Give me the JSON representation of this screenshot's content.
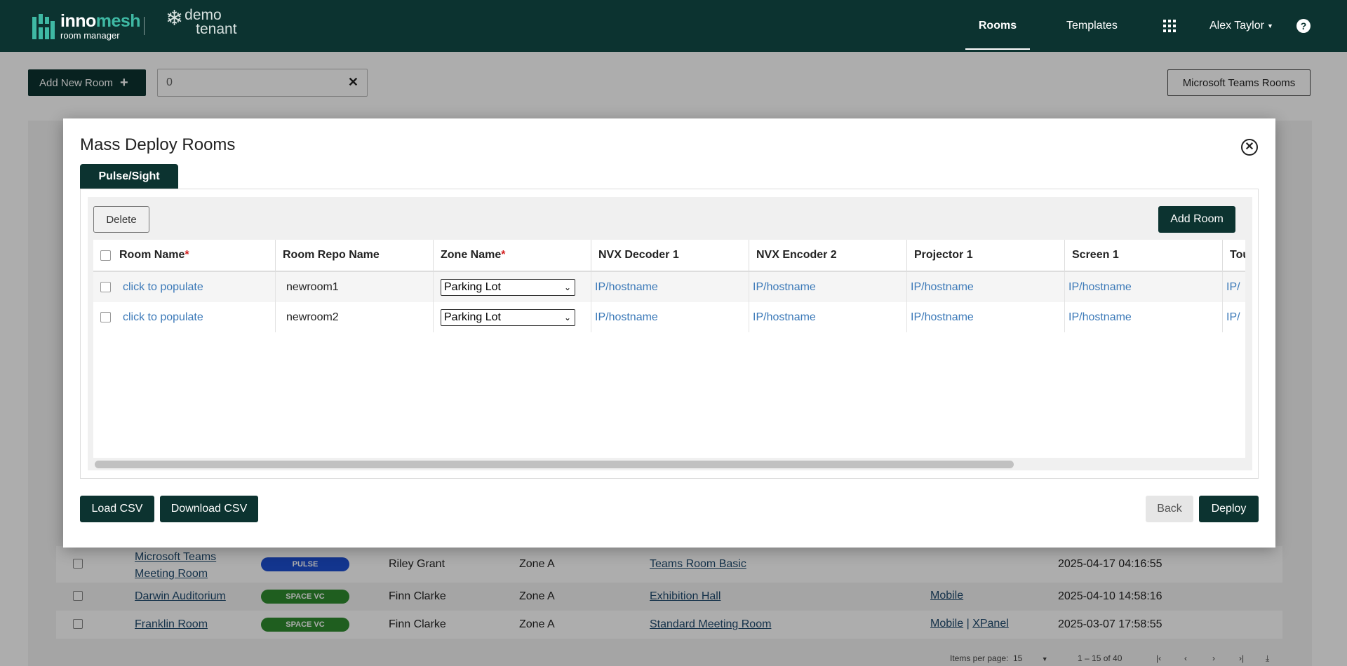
{
  "header": {
    "logo_brand_light": "inno",
    "logo_brand_bold": "mesh",
    "logo_sub": "room manager",
    "tenant_line1": "demo",
    "tenant_line2": "tenant",
    "nav": {
      "rooms": "Rooms",
      "templates": "Templates",
      "user": "Alex Taylor",
      "help": "?"
    }
  },
  "background": {
    "add_new_room": "Add New Room",
    "search_value": "0",
    "teams_button": "Microsoft Teams Rooms",
    "rows": [
      {
        "name": "Microsoft Teams Meeting Room",
        "badge": "PULSE",
        "badge_color": "#1c4fd1",
        "owner": "Riley Grant",
        "zone": "Zone A",
        "template": "Teams Room Basic",
        "link1": "",
        "link2": "",
        "date": "2025-04-17 04:16:55"
      },
      {
        "name": "Darwin Auditorium",
        "badge": "SPACE VC",
        "badge_color": "#2e8b2e",
        "owner": "Finn Clarke",
        "zone": "Zone A",
        "template": "Exhibition Hall",
        "link1": "Mobile",
        "link2": "",
        "date": "2025-04-10 14:58:16"
      },
      {
        "name": "Franklin Room",
        "badge": "SPACE VC",
        "badge_color": "#2e8b2e",
        "owner": "Finn Clarke",
        "zone": "Zone A",
        "template": "Standard Meeting Room",
        "link1": "Mobile",
        "link2": "XPanel",
        "date": "2025-03-07 17:58:55"
      }
    ],
    "paginator": {
      "items_per_page_label": "Items per page:",
      "items_per_page": "15",
      "range": "1 – 15 of 40"
    }
  },
  "modal": {
    "title": "Mass Deploy Rooms",
    "tab": "Pulse/Sight",
    "delete": "Delete",
    "add_room": "Add Room",
    "columns": [
      "Room Name",
      "Room Repo Name",
      "Zone Name",
      "NVX Decoder 1",
      "NVX Encoder 2",
      "Projector 1",
      "Screen 1",
      "Tou"
    ],
    "required_mark": "*",
    "rows": [
      {
        "room_name": "click to populate",
        "repo_name": "newroom1",
        "zone": "Parking Lot",
        "nvx_decoder": "IP/hostname",
        "nvx_encoder": "IP/hostname",
        "projector": "IP/hostname",
        "screen": "IP/hostname",
        "touch": "IP/"
      },
      {
        "room_name": "click to populate",
        "repo_name": "newroom2",
        "zone": "Parking Lot",
        "nvx_decoder": "IP/hostname",
        "nvx_encoder": "IP/hostname",
        "projector": "IP/hostname",
        "screen": "IP/hostname",
        "touch": "IP/"
      }
    ],
    "load_csv": "Load CSV",
    "download_csv": "Download CSV",
    "back": "Back",
    "deploy": "Deploy"
  }
}
